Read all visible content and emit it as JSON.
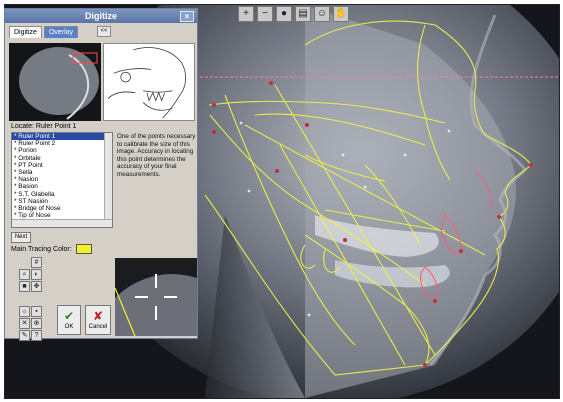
{
  "window": {
    "title": "Digitize",
    "close_glyph": "×"
  },
  "tabs": [
    {
      "label": "Digitize"
    },
    {
      "label": "Overlay"
    }
  ],
  "collapse_glyph": "<<",
  "locate": {
    "label": "Locate:",
    "value": "Ruler Point 1"
  },
  "points": [
    "* Ruler Point 1",
    "* Ruler Point 2",
    "* Porion",
    "* Orbitale",
    "* PT Point",
    "* Sella",
    "* Nasion",
    "* Basion",
    "* S.T. Glabella",
    "* ST Nasion",
    "* Bridge of Nose",
    "* Tip of Nose"
  ],
  "help_text": "One of the points necessary to calibrate the size of this image. Accuracy in locating this point determines the accuracy of your final measurements.",
  "next_label": "Next",
  "tracing_color_label": "Main Tracing Color:",
  "colors": {
    "tracing": "#f2f22a",
    "panel_bg": "#d4d0c8",
    "title_bar": "#6a84b6",
    "crosshair_line": "#ff6b8a"
  },
  "ok_label": "OK",
  "cancel_label": "Cancel",
  "tool_icons": [
    "grid-icon",
    "zoom-icon",
    "contrast-icon",
    "color-icon",
    "eraser-icon",
    "move-icon",
    "pencil-icon",
    "help-icon"
  ],
  "toolbar_icons": [
    "zoom-in-icon",
    "zoom-out-icon",
    "record-icon",
    "ruler-icon",
    "person-icon",
    "hand-icon"
  ]
}
